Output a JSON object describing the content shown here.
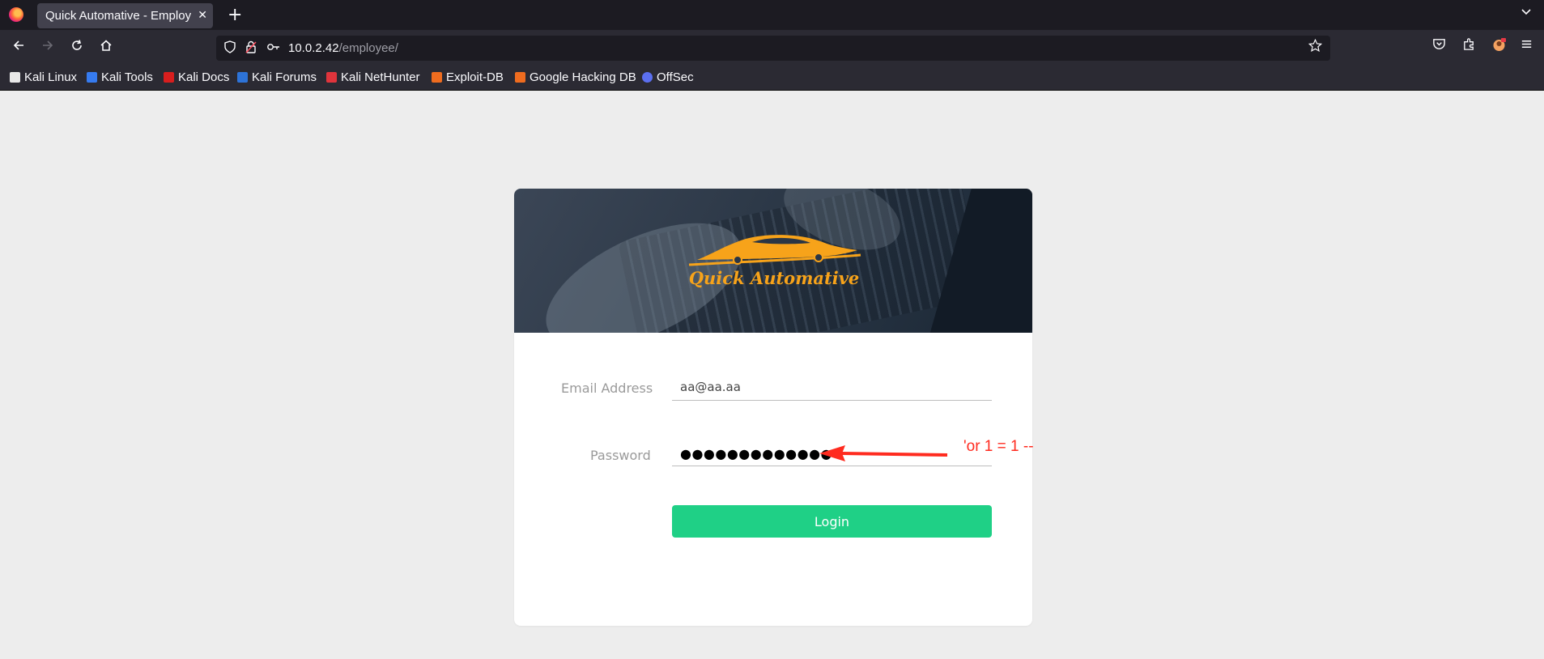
{
  "browser": {
    "tab_title": "Quick Automative - Employee Login",
    "tab_close": "✕",
    "new_tab": "+",
    "url_host": "10.0.2.42",
    "url_path": "/employee/"
  },
  "bookmarks": [
    {
      "label": "Kali Linux",
      "icon": "kali-dragon-icon",
      "color": "#3a3a3a"
    },
    {
      "label": "Kali Tools",
      "icon": "kali-tools-icon",
      "color": "#367bf0"
    },
    {
      "label": "Kali Docs",
      "icon": "kali-docs-icon",
      "color": "#d81e1e"
    },
    {
      "label": "Kali Forums",
      "icon": "kali-forums-icon",
      "color": "#2d73d8"
    },
    {
      "label": "Kali NetHunter",
      "icon": "kali-nethunter-icon",
      "color": "#e0343c"
    },
    {
      "label": "Exploit-DB",
      "icon": "exploit-db-icon",
      "color": "#ef6c1f"
    },
    {
      "label": "Google Hacking DB",
      "icon": "ghdb-icon",
      "color": "#ef6c1f"
    },
    {
      "label": "OffSec",
      "icon": "offsec-icon",
      "color": "#5b6ff0"
    }
  ],
  "login": {
    "brand": "Quick Automative",
    "email_label": "Email Address",
    "email_value": "aa@aa.aa",
    "password_label": "Password",
    "password_masked": "●●●●●●●●●●●●●",
    "login_button": "Login"
  },
  "annotation": {
    "text": "'or 1 = 1 --",
    "color": "#ff2b1f"
  },
  "colors": {
    "accent_button": "#1fd086",
    "brand_orange": "#f7a31a",
    "page_background": "#ededed"
  }
}
